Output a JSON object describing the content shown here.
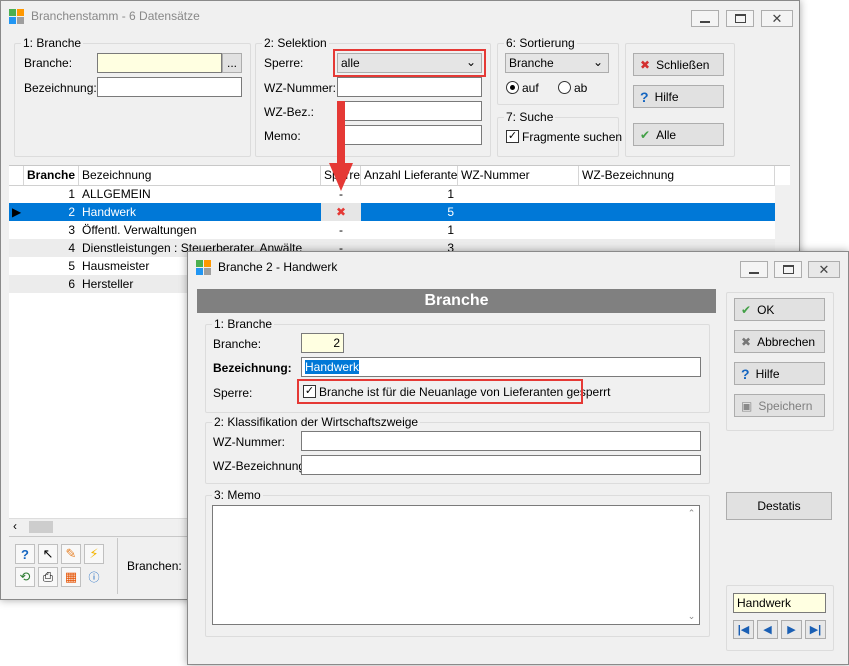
{
  "main_window": {
    "title": "Branchenstamm - 6 Datensätze",
    "branche_group": {
      "legend": "1: Branche",
      "branche_label": "Branche:",
      "branche_value": "",
      "browse_label": "...",
      "bezeichnung_label": "Bezeichnung:",
      "bezeichnung_value": ""
    },
    "selektion_group": {
      "legend": "2: Selektion",
      "sperre_label": "Sperre:",
      "sperre_value": "alle",
      "wz_nummer_label": "WZ-Nummer:",
      "wz_bez_label": "WZ-Bez.:",
      "memo_label": "Memo:"
    },
    "sortierung_group": {
      "legend": "6: Sortierung",
      "sort_value": "Branche",
      "auf_label": "auf",
      "ab_label": "ab"
    },
    "suche_group": {
      "legend": "7: Suche",
      "fragmente_label": "Fragmente suchen"
    },
    "buttons": {
      "schliessen": "Schließen",
      "hilfe": "Hilfe",
      "alle": "Alle"
    },
    "grid": {
      "columns": [
        "Branche",
        "Bezeichnung",
        "Sperre",
        "Anzahl Lieferanten",
        "WZ-Nummer",
        "WZ-Bezeichnung"
      ],
      "rows": [
        {
          "branche": "1",
          "bezeichnung": "ALLGEMEIN",
          "sperre": "-",
          "anzahl": "1",
          "wz_nummer": "",
          "wz_bez": ""
        },
        {
          "branche": "2",
          "bezeichnung": "Handwerk",
          "sperre": "✖",
          "anzahl": "5",
          "wz_nummer": "",
          "wz_bez": ""
        },
        {
          "branche": "3",
          "bezeichnung": "Öffentl. Verwaltungen",
          "sperre": "-",
          "anzahl": "1",
          "wz_nummer": "",
          "wz_bez": ""
        },
        {
          "branche": "4",
          "bezeichnung": "Dienstleistungen : Steuerberater, Anwälte",
          "sperre": "-",
          "anzahl": "3",
          "wz_nummer": "",
          "wz_bez": ""
        },
        {
          "branche": "5",
          "bezeichnung": "Hausmeister",
          "sperre": "",
          "anzahl": "",
          "wz_nummer": "",
          "wz_bez": ""
        },
        {
          "branche": "6",
          "bezeichnung": "Hersteller",
          "sperre": "",
          "anzahl": "",
          "wz_nummer": "",
          "wz_bez": ""
        }
      ]
    },
    "status": {
      "branchen_label": "Branchen:"
    }
  },
  "dialog": {
    "title": "Branche 2 - Handwerk",
    "header": "Branche",
    "branche_group": {
      "legend": "1: Branche",
      "branche_label": "Branche:",
      "branche_value": "2",
      "bezeichnung_label": "Bezeichnung:",
      "bezeichnung_value": "Handwerk",
      "sperre_label": "Sperre:",
      "sperre_checkbox_label": "Branche ist für die Neuanlage von Lieferanten gesperrt"
    },
    "klassifikation_group": {
      "legend": "2:  Klassifikation der Wirtschaftszweige",
      "wz_nummer_label": "WZ-Nummer:",
      "wz_bezeichnung_label": "WZ-Bezeichnung:"
    },
    "memo_group": {
      "legend": "3: Memo"
    },
    "buttons": {
      "ok": "OK",
      "abbrechen": "Abbrechen",
      "hilfe": "Hilfe",
      "speichern": "Speichern",
      "destatis": "Destatis"
    },
    "current_record": "Handwerk"
  }
}
